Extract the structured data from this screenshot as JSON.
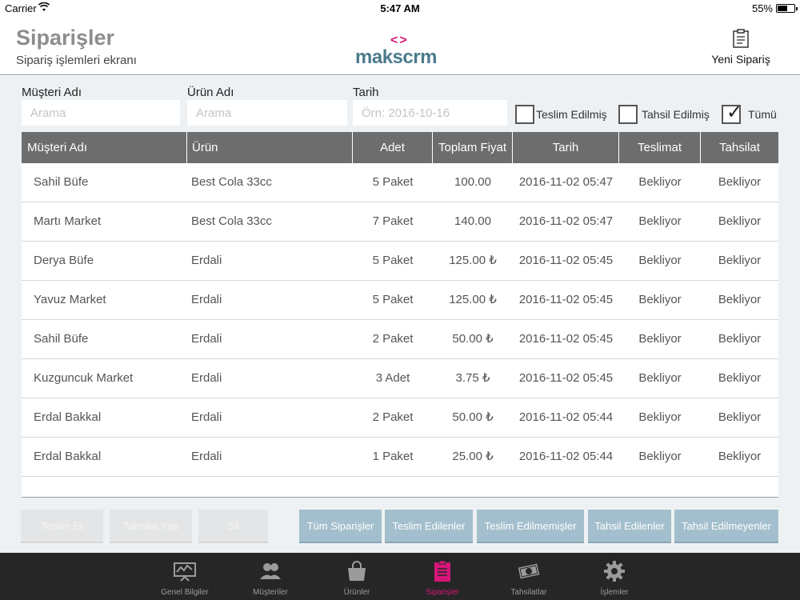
{
  "status_bar": {
    "carrier": "Carrier",
    "time": "5:47 AM",
    "battery": "55%"
  },
  "header": {
    "title": "Siparişler",
    "subtitle": "Sipariş işlemleri ekranı",
    "logo_mark": "<>",
    "logo_text": "makscrm",
    "new_order_label": "Yeni Sipariş"
  },
  "filters": {
    "customer_label": "Müşteri Adı",
    "customer_placeholder": "Arama",
    "product_label": "Ürün Adı",
    "product_placeholder": "Arama",
    "date_label": "Tarih",
    "date_placeholder": "Örn: 2016-10-16",
    "checkboxes": [
      {
        "label": "Teslim Edilmiş",
        "checked": false
      },
      {
        "label": "Tahsil Edilmiş",
        "checked": false
      },
      {
        "label": "Tümü",
        "checked": true
      }
    ]
  },
  "table": {
    "columns": [
      "Müşteri Adı",
      "Ürün",
      "Adet",
      "Toplam Fiyat",
      "Tarih",
      "Teslimat",
      "Tahsilat"
    ],
    "rows": [
      [
        "Sahil Büfe",
        "Best Cola 33cc",
        "5 Paket",
        "100.00",
        "2016-11-02 05:47",
        "Bekliyor",
        "Bekliyor"
      ],
      [
        "Martı Market",
        "Best Cola 33cc",
        "7 Paket",
        "140.00",
        "2016-11-02 05:47",
        "Bekliyor",
        "Bekliyor"
      ],
      [
        "Derya Büfe",
        "Erdali",
        "5 Paket",
        "125.00 ₺",
        "2016-11-02 05:45",
        "Bekliyor",
        "Bekliyor"
      ],
      [
        "Yavuz Market",
        "Erdali",
        "5 Paket",
        "125.00 ₺",
        "2016-11-02 05:45",
        "Bekliyor",
        "Bekliyor"
      ],
      [
        "Sahil Büfe",
        "Erdali",
        "2 Paket",
        "50.00 ₺",
        "2016-11-02 05:45",
        "Bekliyor",
        "Bekliyor"
      ],
      [
        "Kuzguncuk Market",
        "Erdali",
        "3 Adet",
        "3.75 ₺",
        "2016-11-02 05:45",
        "Bekliyor",
        "Bekliyor"
      ],
      [
        "Erdal Bakkal",
        "Erdali",
        "2 Paket",
        "50.00 ₺",
        "2016-11-02 05:44",
        "Bekliyor",
        "Bekliyor"
      ],
      [
        "Erdal Bakkal",
        "Erdali",
        "1 Paket",
        "25.00 ₺",
        "2016-11-02 05:44",
        "Bekliyor",
        "Bekliyor"
      ]
    ]
  },
  "actions": {
    "deliver": "Teslim Et",
    "collect": "Tahsilat Yap",
    "delete": "Sil",
    "all_orders": "Tüm Siparişler",
    "delivered": "Teslim Edilenler",
    "not_delivered": "Teslim Edilmemişler",
    "collected": "Tahsil Edilenler",
    "not_collected": "Tahsil Edilmeyenler"
  },
  "tabbar": {
    "items": [
      {
        "label": "Genel Bilgiler",
        "icon": "presentation-board-icon",
        "active": false
      },
      {
        "label": "Müşteriler",
        "icon": "users-icon",
        "active": false
      },
      {
        "label": "Ürünler",
        "icon": "shopping-bag-icon",
        "active": false
      },
      {
        "label": "Siparişler",
        "icon": "clipboard-icon",
        "active": true
      },
      {
        "label": "Tahsilatlar",
        "icon": "cash-icon",
        "active": false
      },
      {
        "label": "İşlemler",
        "icon": "gear-icon",
        "active": false
      }
    ]
  },
  "colors": {
    "accent": "#d6157a",
    "logo_text": "#4b7b8c",
    "table_header": "#6d6d6d",
    "filter_button": "#a3bfcd",
    "tabbar_bg": "#262626",
    "content_bg": "#eef1f3"
  }
}
